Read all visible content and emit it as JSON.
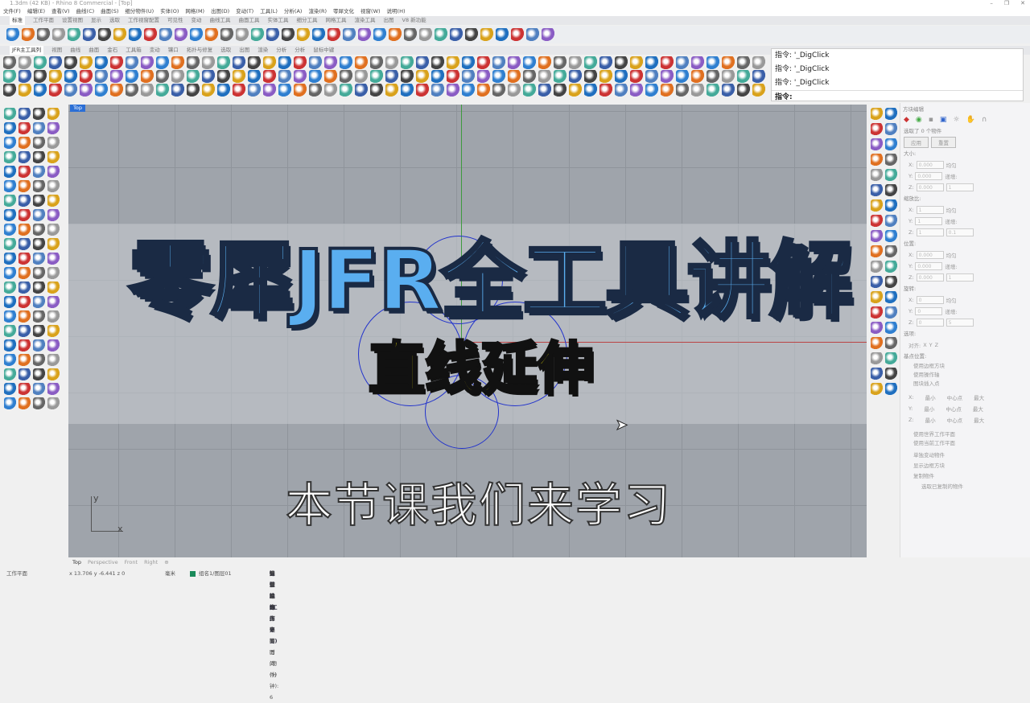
{
  "window": {
    "title": "1.3dm (42 KB) - Rhino 8 Commercial - [Top]",
    "controls": [
      "–",
      "❐",
      "✕"
    ]
  },
  "menu": [
    "文件(F)",
    "编辑(E)",
    "查看(V)",
    "曲线(C)",
    "曲面(S)",
    "细分物件(U)",
    "实体(O)",
    "网格(M)",
    "出图(D)",
    "变动(T)",
    "工具(L)",
    "分析(A)",
    "渲染(R)",
    "零犀文化",
    "视窗(W)",
    "说明(H)"
  ],
  "toolbar_tabs": [
    "标准",
    "工作平面",
    "设置视图",
    "显示",
    "选取",
    "工作视窗配置",
    "可见性",
    "变动",
    "曲线工具",
    "曲面工具",
    "实体工具",
    "细分工具",
    "网格工具",
    "渲染工具",
    "出图",
    "V8 新功能"
  ],
  "jfr_tabs": [
    "JFR主工具列",
    "视图",
    "曲线",
    "曲面",
    "金石",
    "工具箱",
    "变动",
    "镶口",
    "拓扑与修复",
    "选取",
    "出图",
    "渲染",
    "分析",
    "分析",
    "鼠标中键"
  ],
  "command": {
    "history": [
      "指令: '_DigClick",
      "指令: '_DigClick",
      "指令: '_DigClick"
    ],
    "prompt": "指令:"
  },
  "viewport": {
    "label": "Top",
    "axis_x": "x",
    "axis_y": "y"
  },
  "overlay": {
    "title": "零犀JFR全工具讲解",
    "subtitle": "直线延伸",
    "caption": "本节课我们来学习"
  },
  "panel": {
    "title": "方块编辑",
    "selected": "选取了 0 个物件",
    "apply": "应用",
    "reset": "重置",
    "sections": [
      {
        "name": "大小:",
        "rows": [
          [
            "X:",
            "0.000",
            "均匀"
          ],
          [
            "Y:",
            "0.000",
            "递增:"
          ],
          [
            "Z:",
            "0.000",
            "1"
          ]
        ]
      },
      {
        "name": "缩放比:",
        "rows": [
          [
            "X:",
            "1",
            "均匀"
          ],
          [
            "Y:",
            "1",
            "递增:"
          ],
          [
            "Z:",
            "1",
            "0.1"
          ]
        ]
      },
      {
        "name": "位置:",
        "rows": [
          [
            "X:",
            "0.000",
            "均匀"
          ],
          [
            "Y:",
            "0.000",
            "递增:"
          ],
          [
            "Z:",
            "0.000",
            "1"
          ]
        ]
      },
      {
        "name": "旋转:",
        "rows": [
          [
            "X:",
            "0",
            "均匀"
          ],
          [
            "Y:",
            "0",
            "递增:"
          ],
          [
            "Z:",
            "0",
            "5"
          ]
        ]
      }
    ],
    "options_label": "选项:",
    "axis_row": [
      "对齐:",
      "X",
      "Y",
      "Z"
    ],
    "basepoint_label": "基点位置:",
    "basepoint_opts": [
      "使用边框方块",
      "使用操作轴",
      "图块插入点"
    ],
    "xyz_rows": [
      [
        "X:",
        "最小",
        "中心点",
        "最大"
      ],
      [
        "Y:",
        "最小",
        "中心点",
        "最大"
      ],
      [
        "Z:",
        "最小",
        "中心点",
        "最大"
      ]
    ],
    "plane_opts": [
      "使用世界工作平面",
      "使用当前工作平面"
    ],
    "checks": [
      "单独变动物件",
      "显示边框方块",
      "复制物件",
      "选取已复制的物件"
    ]
  },
  "viewport_tabs": [
    "Top",
    "Perspective",
    "Front",
    "Right",
    "⊕"
  ],
  "status": {
    "cplane": "工作平面",
    "coords": "x 13.706  y -6.441  z 0",
    "units": "毫米",
    "layer": "组名1/图层01",
    "layer_color": "#1a8a5a",
    "toggles": [
      "锁定格点",
      "正交",
      "平面模式",
      "物件锁点",
      "智慧轨迹",
      "操作轴 (工作平面)",
      "自动对齐工作平面 (物件)",
      "记录建构历史",
      "过滤器",
      "距离上次保存的时间 (分钟): 6"
    ]
  },
  "colors": {
    "accent": "#2b6fd6",
    "title_fill": "#5aaef0",
    "subtitle_fill": "#f8ec00"
  }
}
